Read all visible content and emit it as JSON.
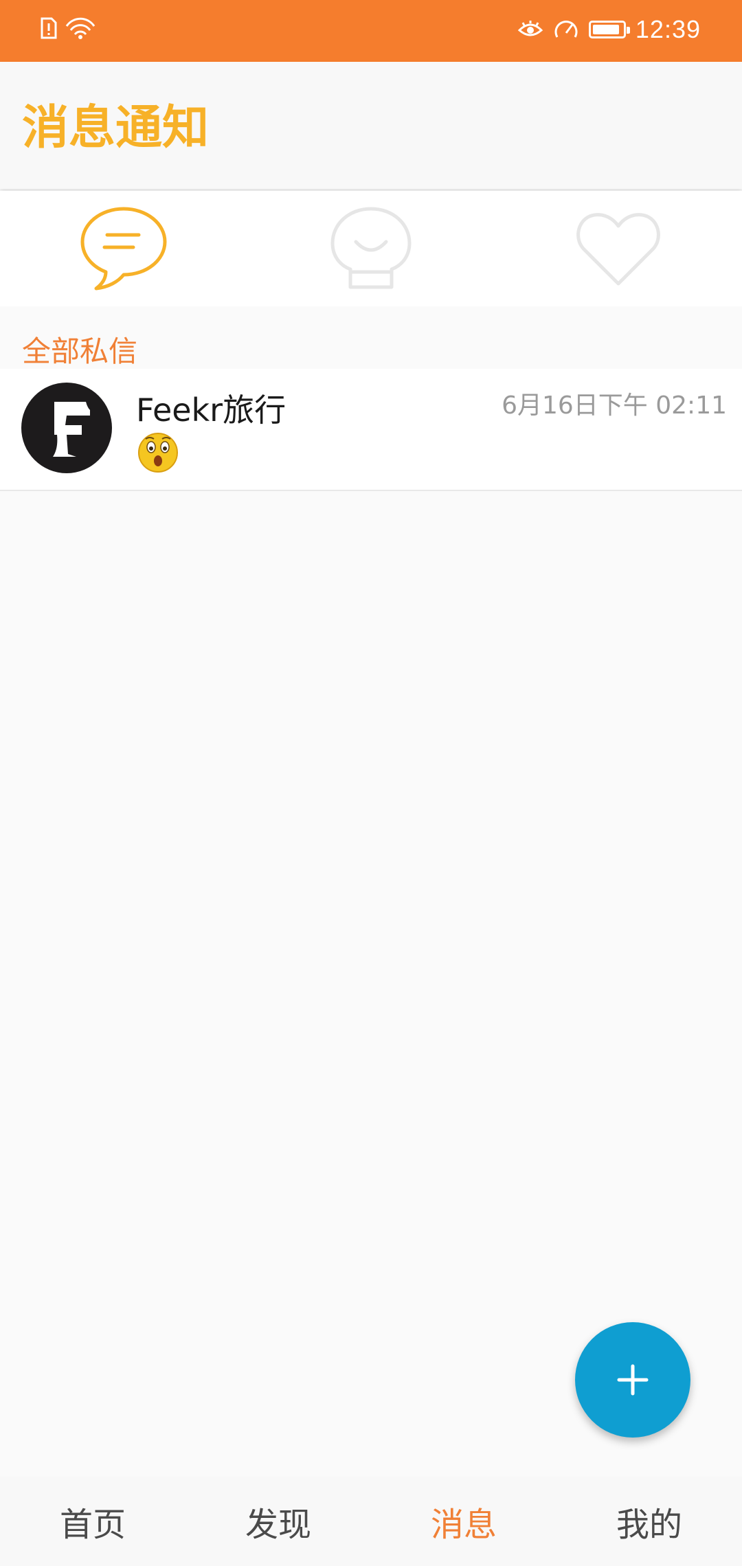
{
  "status_bar": {
    "time": "12:39",
    "icons": [
      "sim-alert-icon",
      "wifi-icon",
      "eye-icon",
      "speed-icon",
      "battery-icon"
    ],
    "battery_level": 0.9
  },
  "header": {
    "title": "消息通知"
  },
  "tabs": [
    {
      "icon": "chat-bubble-icon",
      "active": true
    },
    {
      "icon": "contacts-icon",
      "active": false
    },
    {
      "icon": "heart-icon",
      "active": false
    }
  ],
  "section": {
    "label": "全部私信"
  },
  "messages": [
    {
      "name": "Feekr旅行",
      "time": "6月16日下午 02:11",
      "preview_icon": "surprised-emoji-icon",
      "avatar_icon": "feekr-logo-icon"
    }
  ],
  "fab": {
    "icon": "plus-icon"
  },
  "bottom_nav": [
    {
      "label": "首页",
      "active": false
    },
    {
      "label": "发现",
      "active": false
    },
    {
      "label": "消息",
      "active": true
    },
    {
      "label": "我的",
      "active": false
    }
  ],
  "colors": {
    "status_bar": "#f57d2d",
    "title": "#f7b128",
    "accent": "#f08036",
    "fab": "#0f9ed1",
    "inactive_icon": "#e6e6e6"
  }
}
